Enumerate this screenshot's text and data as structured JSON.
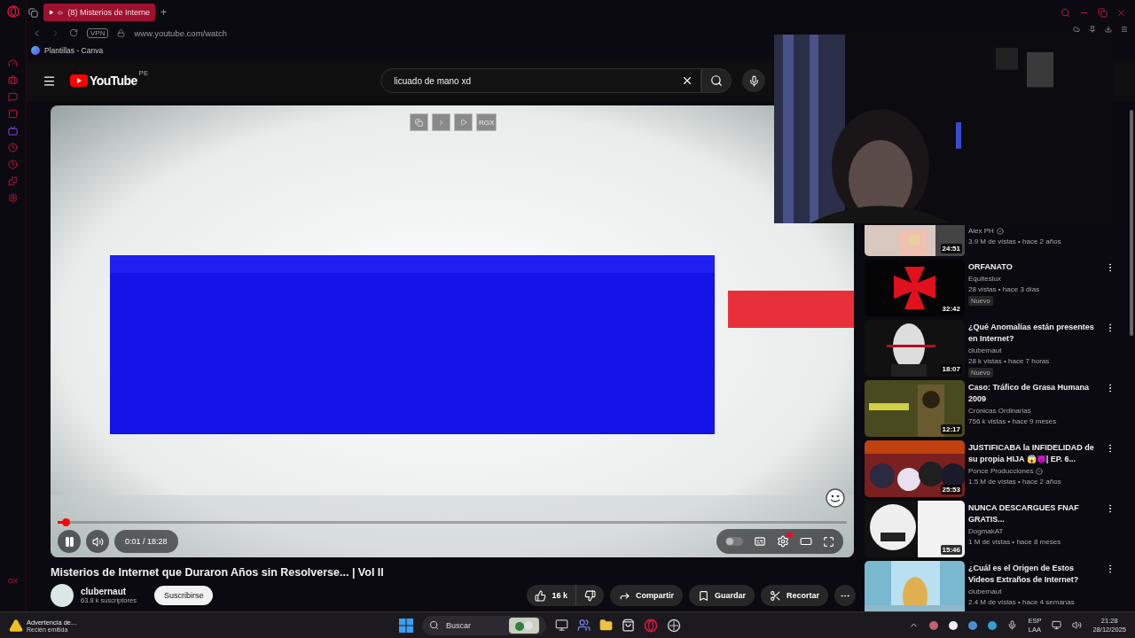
{
  "browser": {
    "tab": {
      "title": "(8) Misterios de Interne",
      "selected": true
    },
    "new_tab": "+",
    "vpn": "VPN",
    "address": "www.youtube.com/watch",
    "bookmark": "Plantillas - Canva",
    "sidebar_label": "GX"
  },
  "youtube": {
    "logo": "YouTube",
    "region": "PE",
    "search": {
      "value": "licuado de mano xd"
    }
  },
  "player": {
    "toolbar_label": "RGX",
    "playing": true,
    "autoplay": {
      "on": false
    },
    "time": "0:01 / 18:28",
    "progress": {
      "level": 0.01
    }
  },
  "video": {
    "title": "Misterios de Internet que Duraron Años sin Resolverse... | Vol II",
    "channel": "clubernaut",
    "subscribers": "63.8 k suscriptores",
    "subscribe": "Suscribirse",
    "likes": "16 k",
    "actions": [
      {
        "kind": "share",
        "label": "Compartir"
      },
      {
        "kind": "save",
        "label": "Guardar"
      },
      {
        "kind": "clip",
        "label": "Recortar"
      }
    ]
  },
  "recommendations": [
    {
      "channel": "Alex PH",
      "verified": true,
      "meta": "3.9 M de vistas • hace 2 años",
      "duration": "24:51"
    },
    {
      "title": "ORFANATO",
      "channel": "Equiteslux",
      "verified": false,
      "meta": "28 vistas • hace 3 días",
      "duration": "32:42",
      "badge": "Nuevo"
    },
    {
      "title": "¿Qué Anomalías están presentes en Internet?",
      "channel": "clubernaut",
      "verified": false,
      "meta": "28 k vistas • hace 7 horas",
      "duration": "18:07",
      "badge": "Nuevo"
    },
    {
      "title": "Caso: Tráfico de Grasa Humana 2009",
      "channel": "Crónicas Ordinarias",
      "verified": false,
      "meta": "756 k vistas • hace 9 meses",
      "duration": "12:17"
    },
    {
      "title": "JUSTIFICABA la INFIDELIDAD de su propia HIJA 😱👿| EP. 6...",
      "channel": "Ponce Producciones",
      "verified": true,
      "meta": "1.5 M de vistas • hace 2 años",
      "duration": "25:53"
    },
    {
      "title": "NUNCA DESCARGUES FNAF GRATIS...",
      "channel": "DogmakAT",
      "verified": false,
      "meta": "1 M de vistas • hace 8 meses",
      "duration": "15:46"
    },
    {
      "title": "¿Cuál es el Origen de Estos Videos Extraños de Internet?",
      "channel": "clubernaut",
      "verified": false,
      "meta": "2.4 M de vistas • hace 4 semanas"
    }
  ],
  "taskbar": {
    "notification": {
      "title": "Advertencia de...",
      "subtitle": "Recién emitida"
    },
    "search_placeholder": "Buscar",
    "language": [
      "ESP",
      "LAA"
    ],
    "time": "21:28",
    "date": "28/12/2025"
  }
}
